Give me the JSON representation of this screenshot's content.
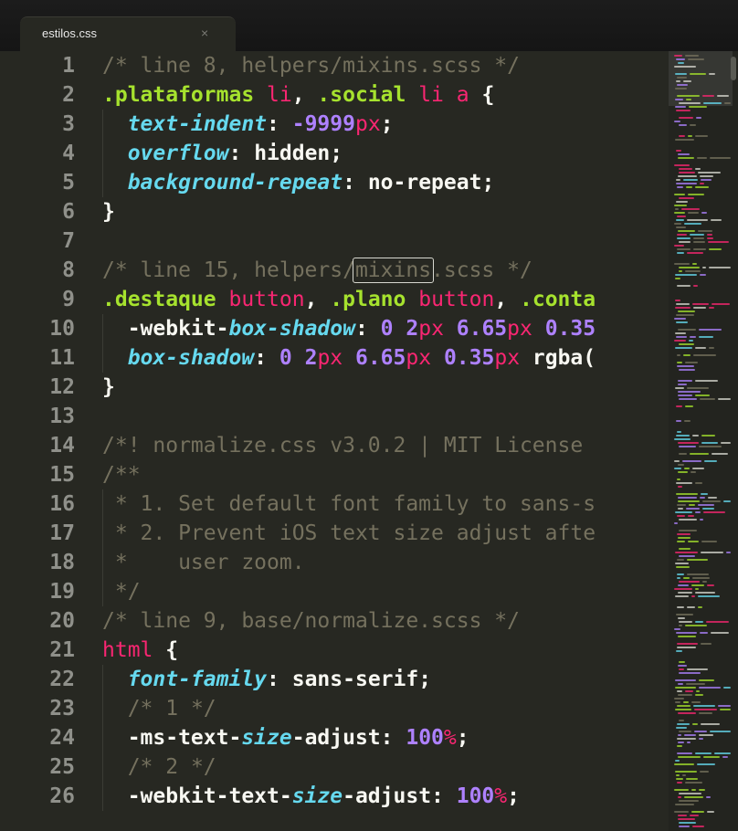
{
  "tab": {
    "label": "estilos.css",
    "close": "×"
  },
  "editor": {
    "lines": [
      {
        "n": "1",
        "parts": [
          [
            "c",
            "/* line 8, helpers/mixins.scss */"
          ]
        ]
      },
      {
        "n": "2",
        "parts": [
          [
            "sel",
            ".plataformas "
          ],
          [
            "tag",
            "li"
          ],
          [
            "pn",
            ", "
          ],
          [
            "sel",
            ".social "
          ],
          [
            "tag",
            "li a"
          ],
          [
            "pn",
            " {"
          ]
        ]
      },
      {
        "n": "3",
        "parts": [
          [
            "pn",
            "  "
          ],
          [
            "prop",
            "text-indent"
          ],
          [
            "pn",
            ": "
          ],
          [
            "num",
            "-9999"
          ],
          [
            "unit",
            "px"
          ],
          [
            "pn",
            ";"
          ]
        ]
      },
      {
        "n": "4",
        "parts": [
          [
            "pn",
            "  "
          ],
          [
            "prop",
            "overflow"
          ],
          [
            "pn",
            ": "
          ],
          [
            "val",
            "hidden"
          ],
          [
            "pn",
            ";"
          ]
        ]
      },
      {
        "n": "5",
        "parts": [
          [
            "pn",
            "  "
          ],
          [
            "prop",
            "background-repeat"
          ],
          [
            "pn",
            ": "
          ],
          [
            "val",
            "no-repeat"
          ],
          [
            "pn",
            ";"
          ]
        ]
      },
      {
        "n": "6",
        "parts": [
          [
            "pn",
            "}"
          ]
        ]
      },
      {
        "n": "7",
        "parts": []
      },
      {
        "n": "8",
        "parts": [
          [
            "c",
            "/* line 15, helpers/"
          ],
          [
            "c hl",
            "mixins"
          ],
          [
            "c",
            ".scss */"
          ]
        ]
      },
      {
        "n": "9",
        "parts": [
          [
            "sel",
            ".destaque "
          ],
          [
            "tag",
            "button"
          ],
          [
            "pn",
            ", "
          ],
          [
            "sel",
            ".plano "
          ],
          [
            "tag",
            "button"
          ],
          [
            "pn",
            ", "
          ],
          [
            "sel",
            ".conta"
          ]
        ]
      },
      {
        "n": "10",
        "parts": [
          [
            "pn",
            "  -webkit-"
          ],
          [
            "prop",
            "box-shadow"
          ],
          [
            "pn",
            ": "
          ],
          [
            "num",
            "0 2"
          ],
          [
            "unit",
            "px"
          ],
          [
            "num",
            " 6.65"
          ],
          [
            "unit",
            "px"
          ],
          [
            "num",
            " 0.35"
          ]
        ]
      },
      {
        "n": "11",
        "parts": [
          [
            "pn",
            "  "
          ],
          [
            "prop",
            "box-shadow"
          ],
          [
            "pn",
            ": "
          ],
          [
            "num",
            "0 2"
          ],
          [
            "unit",
            "px"
          ],
          [
            "num",
            " 6.65"
          ],
          [
            "unit",
            "px"
          ],
          [
            "num",
            " 0.35"
          ],
          [
            "unit",
            "px"
          ],
          [
            "pn",
            " rgba("
          ]
        ]
      },
      {
        "n": "12",
        "parts": [
          [
            "pn",
            "}"
          ]
        ]
      },
      {
        "n": "13",
        "parts": []
      },
      {
        "n": "14",
        "parts": [
          [
            "c",
            "/*! normalize.css v3.0.2 | MIT License"
          ]
        ]
      },
      {
        "n": "15",
        "parts": [
          [
            "c",
            "/**"
          ]
        ]
      },
      {
        "n": "16",
        "parts": [
          [
            "c",
            " * 1. Set default font family to sans-s"
          ]
        ]
      },
      {
        "n": "17",
        "parts": [
          [
            "c",
            " * 2. Prevent iOS text size adjust afte"
          ]
        ]
      },
      {
        "n": "18",
        "parts": [
          [
            "c",
            " *    user zoom."
          ]
        ]
      },
      {
        "n": "19",
        "parts": [
          [
            "c",
            " */"
          ]
        ]
      },
      {
        "n": "20",
        "parts": [
          [
            "c",
            "/* line 9, base/normalize.scss */"
          ]
        ]
      },
      {
        "n": "21",
        "parts": [
          [
            "tag",
            "html"
          ],
          [
            "pn",
            " {"
          ]
        ]
      },
      {
        "n": "22",
        "parts": [
          [
            "pn",
            "  "
          ],
          [
            "prop",
            "font-family"
          ],
          [
            "pn",
            ": "
          ],
          [
            "val",
            "sans-serif"
          ],
          [
            "pn",
            ";"
          ]
        ]
      },
      {
        "n": "23",
        "parts": [
          [
            "pn",
            "  "
          ],
          [
            "c",
            "/* 1 */"
          ]
        ]
      },
      {
        "n": "24",
        "parts": [
          [
            "pn",
            "  -ms-text-"
          ],
          [
            "prop",
            "size"
          ],
          [
            "pn",
            "-adjust: "
          ],
          [
            "num",
            "100"
          ],
          [
            "unit",
            "%"
          ],
          [
            "pn",
            ";"
          ]
        ]
      },
      {
        "n": "25",
        "parts": [
          [
            "pn",
            "  "
          ],
          [
            "c",
            "/* 2 */"
          ]
        ]
      },
      {
        "n": "26",
        "parts": [
          [
            "pn",
            "  -webkit-text-"
          ],
          [
            "prop",
            "size"
          ],
          [
            "pn",
            "-adjust: "
          ],
          [
            "num",
            "100"
          ],
          [
            "unit",
            "%"
          ],
          [
            "pn",
            ";"
          ]
        ]
      }
    ]
  },
  "colors": {
    "background": "#272822",
    "comment": "#75715e",
    "selector": "#a6e22e",
    "tag": "#f92672",
    "property": "#66d9ef",
    "number": "#ae81ff",
    "text": "#f8f8f2"
  }
}
